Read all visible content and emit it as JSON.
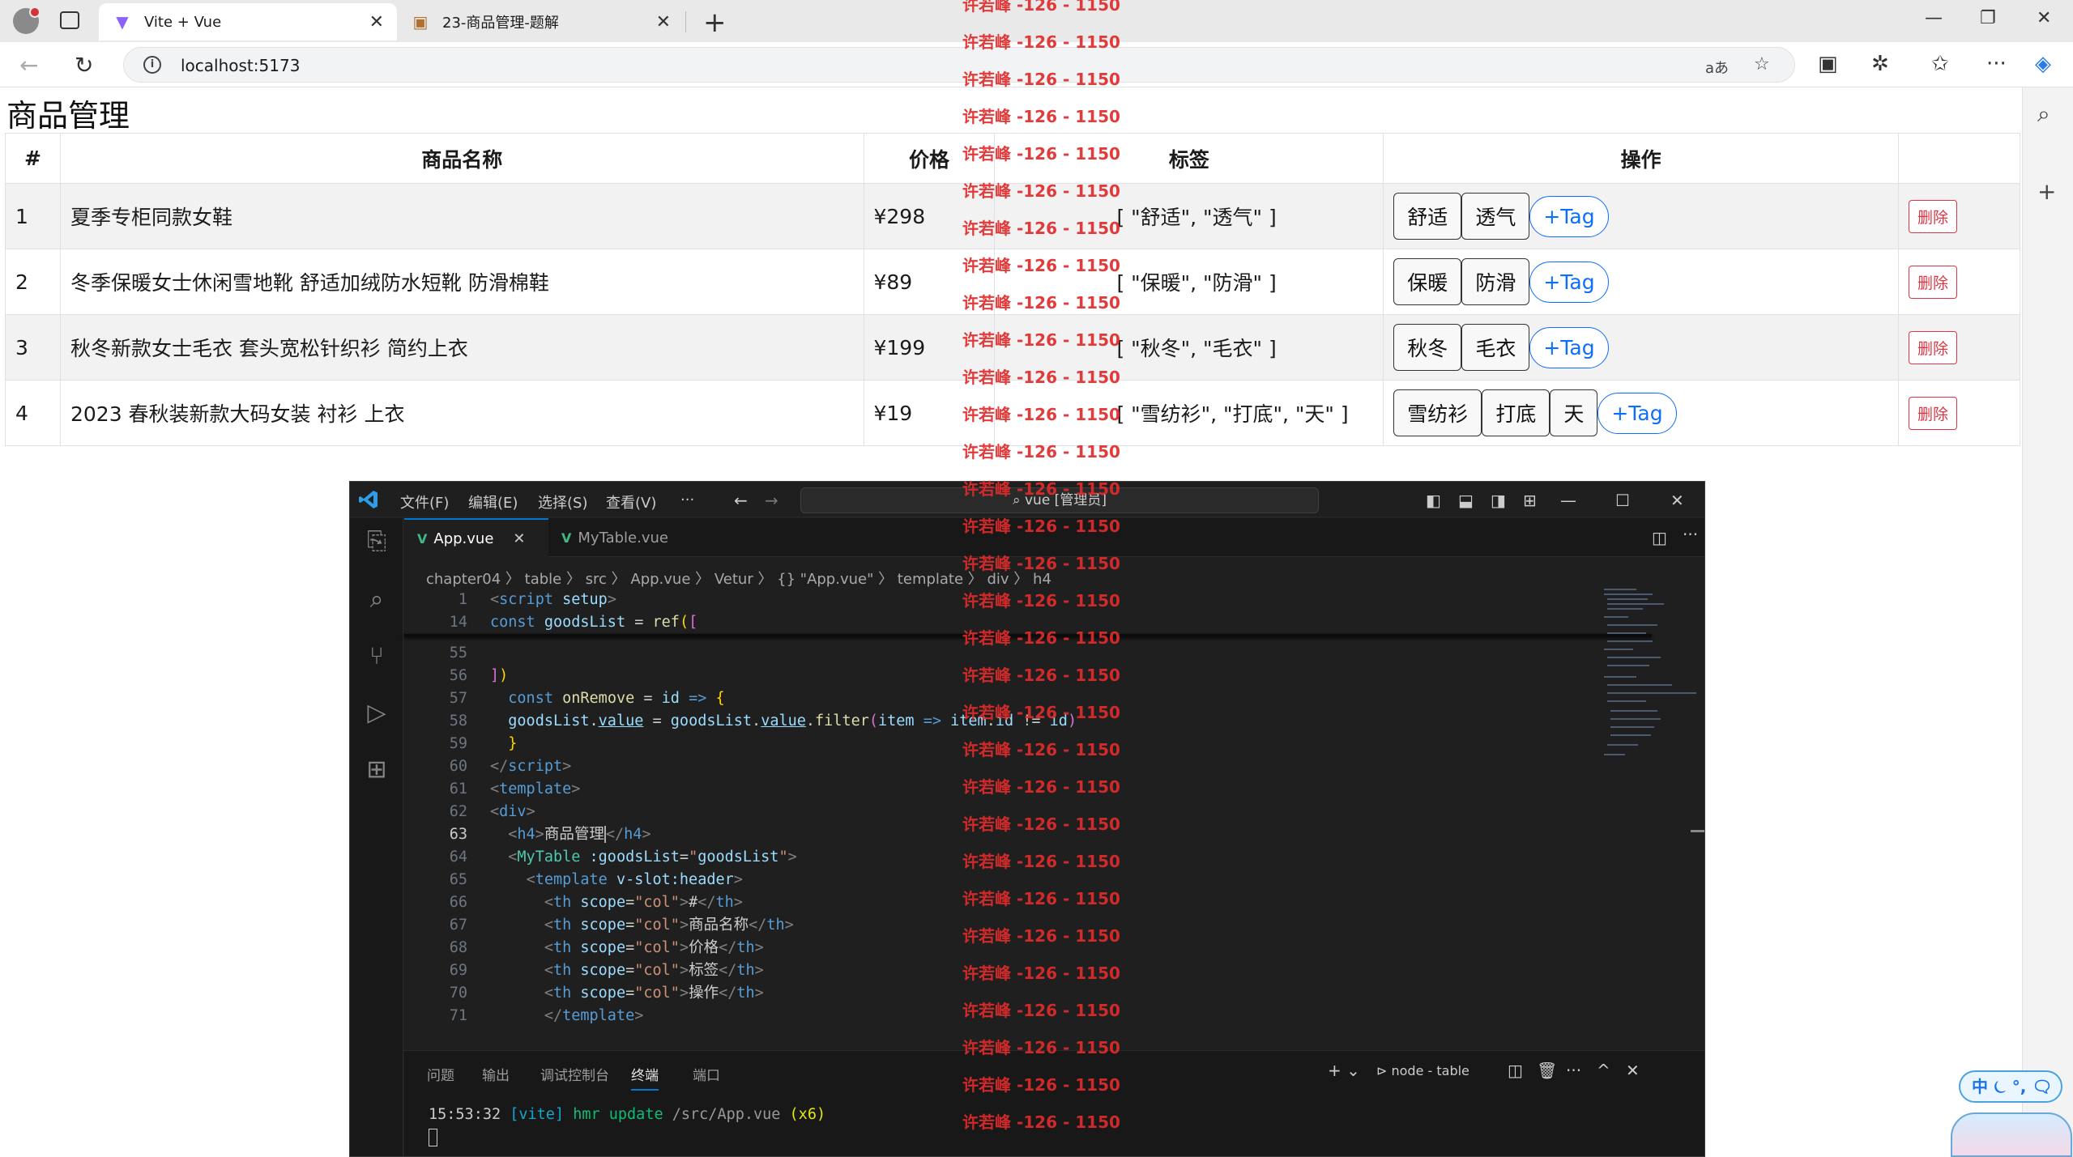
{
  "browser": {
    "tabs": [
      {
        "title": "Vite + Vue",
        "active": true
      },
      {
        "title": "23-商品管理-题解",
        "active": false
      }
    ],
    "url": "localhost:5173",
    "read_aloud_icon": "aあ"
  },
  "page": {
    "heading": "商品管理",
    "table": {
      "headers": [
        "#",
        "商品名称",
        "价格",
        "标签",
        "操作"
      ],
      "rows": [
        {
          "id": "1",
          "name": "夏季专柜同款女鞋",
          "price": "¥298",
          "tags_text": "[ \"舒适\", \"透气\" ]",
          "tags": [
            "舒适",
            "透气"
          ]
        },
        {
          "id": "2",
          "name": "冬季保暖女士休闲雪地靴 舒适加绒防水短靴 防滑棉鞋",
          "price": "¥89",
          "tags_text": "[ \"保暖\", \"防滑\" ]",
          "tags": [
            "保暖",
            "防滑"
          ]
        },
        {
          "id": "3",
          "name": "秋冬新款女士毛衣 套头宽松针织衫 简约上衣",
          "price": "¥199",
          "tags_text": "[ \"秋冬\", \"毛衣\" ]",
          "tags": [
            "秋冬",
            "毛衣"
          ]
        },
        {
          "id": "4",
          "name": "2023 春秋装新款大码女装 衬衫 上衣",
          "price": "¥19",
          "tags_text": "[ \"雪纺衫\", \"打底\", \"天\" ]",
          "tags": [
            "雪纺衫",
            "打底",
            "天"
          ]
        }
      ],
      "add_tag_label": "+Tag",
      "delete_label": "删除"
    }
  },
  "vscode": {
    "menu": [
      "文件(F)",
      "编辑(E)",
      "选择(S)",
      "查看(V)",
      "···"
    ],
    "command_center": "vue [管理员]",
    "tabs": [
      {
        "label": "App.vue",
        "active": true
      },
      {
        "label": "MyTable.vue",
        "active": false
      }
    ],
    "breadcrumb": "chapter04 〉 table 〉 src 〉 App.vue 〉 Vetur 〉 {} \"App.vue\" 〉 template 〉 div 〉 h4",
    "panel_tabs": [
      "问题",
      "输出",
      "调试控制台",
      "终端",
      "端口"
    ],
    "terminal_name": "node - table",
    "terminal_time": "15:53:32",
    "terminal_tag": "[vite]",
    "terminal_msg": "hmr update",
    "terminal_path": "/src/App.vue",
    "terminal_count": "(x6)"
  },
  "watermark": "许若峰 -126 - 1150",
  "ime": "中 ⏾ °, 🗨"
}
